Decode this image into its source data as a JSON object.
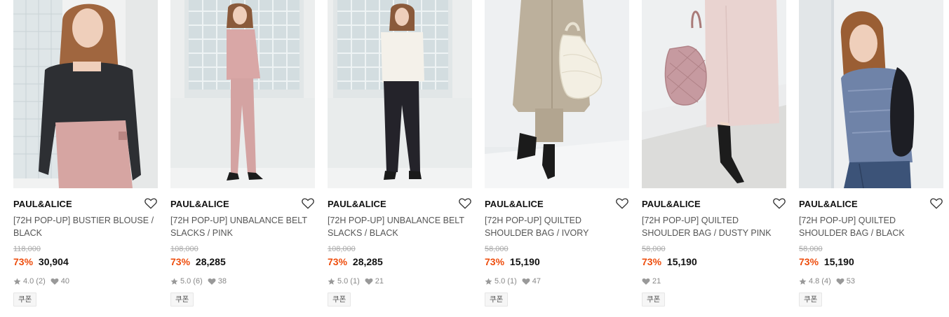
{
  "products": [
    {
      "brand": "PAUL&ALICE",
      "name": "[72H POP-UP] BUSTIER BLOUSE / BLACK",
      "original_price": "118,000",
      "discount": "73%",
      "sale_price": "30,904",
      "rating": "4.0",
      "review_count": "(2)",
      "likes": "40",
      "coupon": "쿠폰",
      "image": "model-black-puff-blouse-pink-pants"
    },
    {
      "brand": "PAUL&ALICE",
      "name": "[72H POP-UP] UNBALANCE BELT SLACKS / PINK",
      "original_price": "108,000",
      "discount": "73%",
      "sale_price": "28,285",
      "rating": "5.0",
      "review_count": "(6)",
      "likes": "38",
      "coupon": "쿠폰",
      "image": "model-pink-suit-glass-block-wall"
    },
    {
      "brand": "PAUL&ALICE",
      "name": "[72H POP-UP] UNBALANCE BELT SLACKS / BLACK",
      "original_price": "108,000",
      "discount": "73%",
      "sale_price": "28,285",
      "rating": "5.0",
      "review_count": "(1)",
      "likes": "21",
      "coupon": "쿠폰",
      "image": "model-white-top-black-slacks"
    },
    {
      "brand": "PAUL&ALICE",
      "name": "[72H POP-UP] QUILTED SHOULDER BAG / IVORY",
      "original_price": "58,000",
      "discount": "73%",
      "sale_price": "15,190",
      "rating": "5.0",
      "review_count": "(1)",
      "likes": "47",
      "coupon": "쿠폰",
      "image": "beige-trench-coat-ivory-bag"
    },
    {
      "brand": "PAUL&ALICE",
      "name": "[72H POP-UP] QUILTED SHOULDER BAG / DUSTY PINK",
      "original_price": "58,000",
      "discount": "73%",
      "sale_price": "15,190",
      "rating": null,
      "review_count": null,
      "likes": "21",
      "coupon": "쿠폰",
      "image": "pink-skirt-dusty-pink-bag"
    },
    {
      "brand": "PAUL&ALICE",
      "name": "[72H POP-UP] QUILTED SHOULDER BAG / BLACK",
      "original_price": "58,000",
      "discount": "73%",
      "sale_price": "15,190",
      "rating": "4.8",
      "review_count": "(4)",
      "likes": "53",
      "coupon": "쿠폰",
      "image": "model-blue-cardigan-black-bag"
    }
  ],
  "icons": {
    "wishlist": "heart-outline-icon",
    "rating": "star-icon",
    "likes": "heart-icon"
  },
  "colors": {
    "discount": "#ee4e0e",
    "text": "#111111",
    "muted": "#888888"
  }
}
